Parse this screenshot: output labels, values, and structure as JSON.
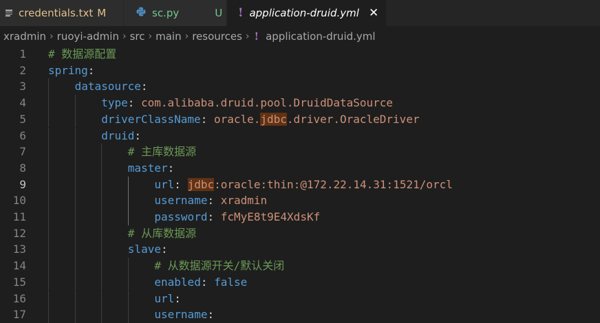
{
  "tabs": [
    {
      "name": "credentials.txt",
      "status": "M",
      "icon": "text-file-icon"
    },
    {
      "name": "sc.py",
      "status": "U",
      "icon": "python-icon"
    },
    {
      "name": "application-druid.yml",
      "icon_glyph": "!",
      "close_glyph": "✕",
      "icon": "yaml-icon"
    }
  ],
  "breadcrumb": {
    "items": [
      "xradmin",
      "ruoyi-admin",
      "src",
      "main",
      "resources",
      "application-druid.yml"
    ],
    "separator": "›",
    "file_glyph": "!"
  },
  "code": {
    "lines": [
      {
        "n": "1",
        "indent": 0,
        "tokens": [
          {
            "t": "# 数据源配置",
            "c": "c"
          }
        ]
      },
      {
        "n": "2",
        "indent": 0,
        "tokens": [
          {
            "t": "spring",
            "c": "k"
          },
          {
            "t": ":",
            "c": "p"
          }
        ]
      },
      {
        "n": "3",
        "indent": 1,
        "tokens": [
          {
            "t": "datasource",
            "c": "k"
          },
          {
            "t": ":",
            "c": "p"
          }
        ]
      },
      {
        "n": "4",
        "indent": 2,
        "tokens": [
          {
            "t": "type",
            "c": "k"
          },
          {
            "t": ": ",
            "c": "p"
          },
          {
            "t": "com.alibaba.druid.pool.DruidDataSource",
            "c": "s"
          }
        ]
      },
      {
        "n": "5",
        "indent": 2,
        "tokens": [
          {
            "t": "driverClassName",
            "c": "k"
          },
          {
            "t": ": ",
            "c": "p"
          },
          {
            "t": "oracle.",
            "c": "s"
          },
          {
            "t": "jdbc",
            "c": "s hl"
          },
          {
            "t": ".driver.OracleDriver",
            "c": "s"
          }
        ]
      },
      {
        "n": "6",
        "indent": 2,
        "tokens": [
          {
            "t": "druid",
            "c": "k"
          },
          {
            "t": ":",
            "c": "p"
          }
        ]
      },
      {
        "n": "7",
        "indent": 3,
        "tokens": [
          {
            "t": "# 主库数据源",
            "c": "c"
          }
        ]
      },
      {
        "n": "8",
        "indent": 3,
        "tokens": [
          {
            "t": "master",
            "c": "k"
          },
          {
            "t": ":",
            "c": "p"
          }
        ]
      },
      {
        "n": "9",
        "indent": 4,
        "current": true,
        "tokens": [
          {
            "t": "url",
            "c": "k"
          },
          {
            "t": ": ",
            "c": "p"
          },
          {
            "t": "jdbc",
            "c": "s hl"
          },
          {
            "t": ":oracle:thin:@172.22.14.31:1521/orcl",
            "c": "s"
          }
        ]
      },
      {
        "n": "10",
        "indent": 4,
        "tokens": [
          {
            "t": "username",
            "c": "k"
          },
          {
            "t": ": ",
            "c": "p"
          },
          {
            "t": "xradmin",
            "c": "s"
          }
        ]
      },
      {
        "n": "11",
        "indent": 4,
        "tokens": [
          {
            "t": "password",
            "c": "k"
          },
          {
            "t": ": ",
            "c": "p"
          },
          {
            "t": "fcMyE8t9E4XdsKf",
            "c": "s"
          }
        ]
      },
      {
        "n": "12",
        "indent": 3,
        "tokens": [
          {
            "t": "# 从库数据源",
            "c": "c"
          }
        ]
      },
      {
        "n": "13",
        "indent": 3,
        "tokens": [
          {
            "t": "slave",
            "c": "k"
          },
          {
            "t": ":",
            "c": "p"
          }
        ]
      },
      {
        "n": "14",
        "indent": 4,
        "tokens": [
          {
            "t": "# 从数据源开关/默认关闭",
            "c": "c"
          }
        ]
      },
      {
        "n": "15",
        "indent": 4,
        "tokens": [
          {
            "t": "enabled",
            "c": "k"
          },
          {
            "t": ": ",
            "c": "p"
          },
          {
            "t": "false",
            "c": "k"
          }
        ]
      },
      {
        "n": "16",
        "indent": 4,
        "tokens": [
          {
            "t": "url",
            "c": "k"
          },
          {
            "t": ":",
            "c": "p"
          }
        ]
      },
      {
        "n": "17",
        "indent": 4,
        "tokens": [
          {
            "t": "username",
            "c": "k"
          },
          {
            "t": ":",
            "c": "p"
          }
        ]
      }
    ]
  }
}
